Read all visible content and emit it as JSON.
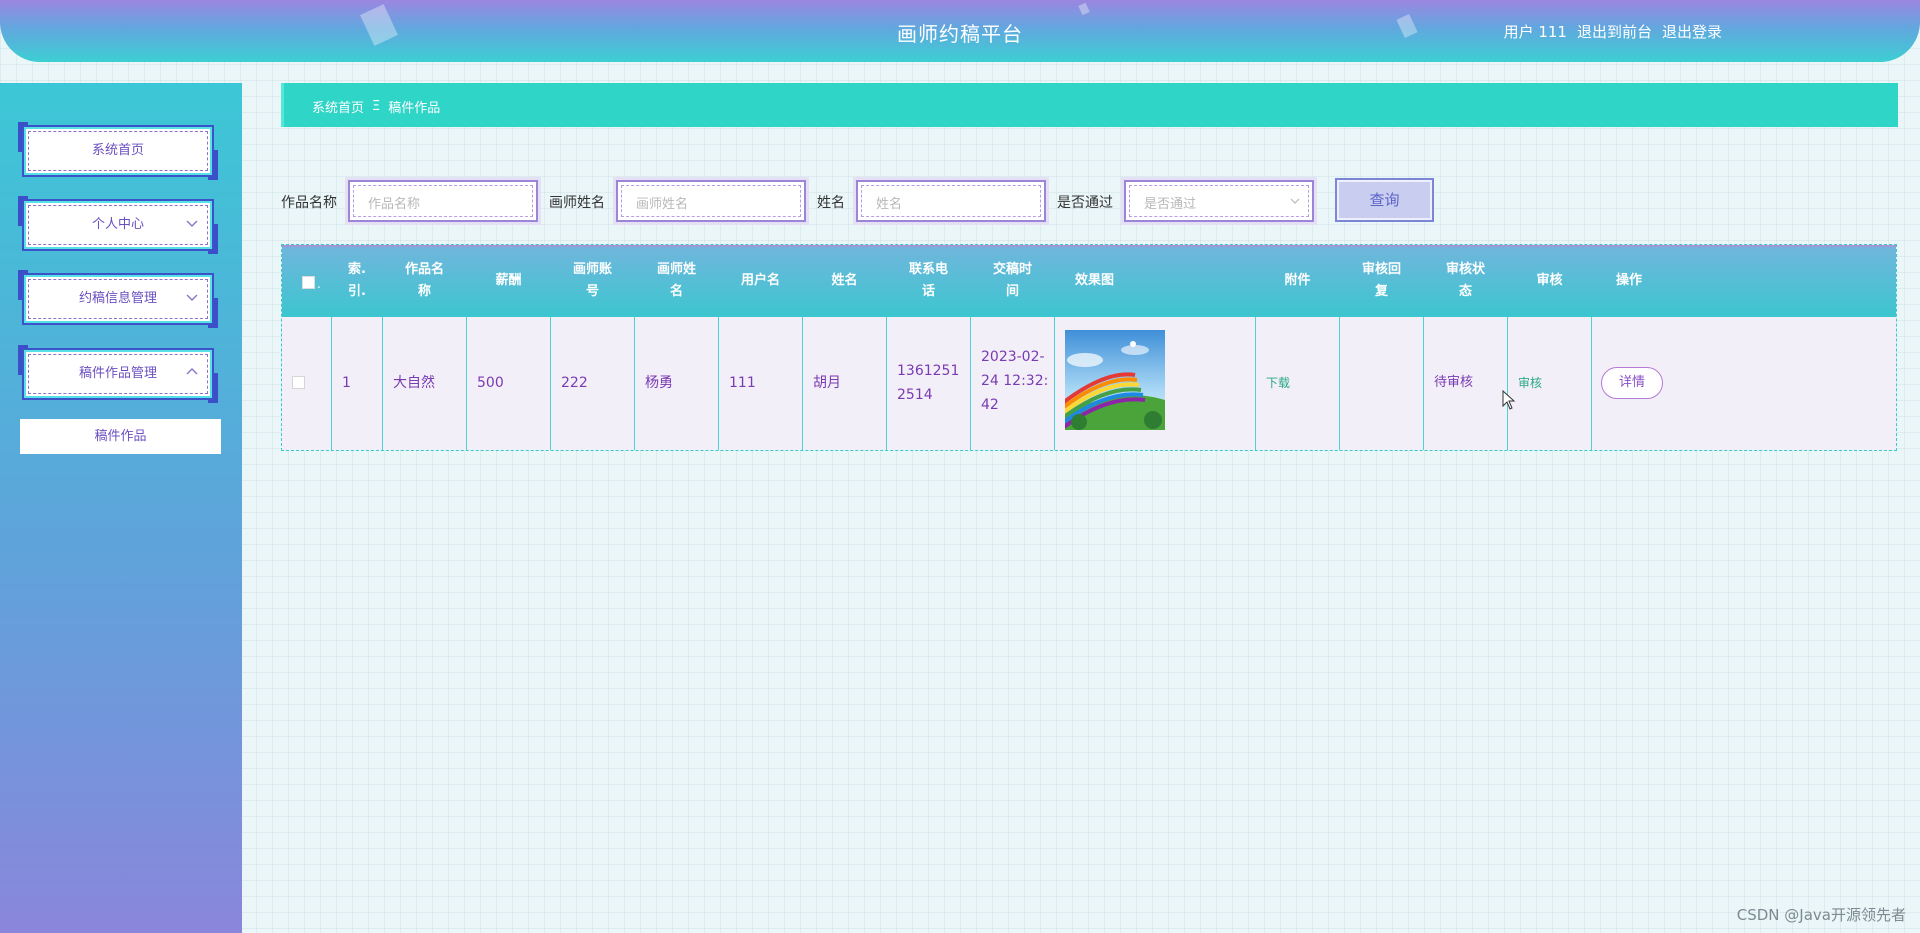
{
  "header": {
    "title": "画师约稿平台",
    "user_label": "用户 111",
    "front_link": "退出到前台",
    "logout_link": "退出登录"
  },
  "sidebar": {
    "items": [
      {
        "label": "系统首页",
        "icon": "none"
      },
      {
        "label": "个人中心",
        "icon": "chevron-down-icon"
      },
      {
        "label": "约稿信息管理",
        "icon": "chevron-down-icon"
      },
      {
        "label": "稿件作品管理",
        "icon": "chevron-up-icon"
      }
    ],
    "sub_item": "稿件作品"
  },
  "breadcrumb": {
    "home": "系统首页",
    "separator": "Ξ",
    "current": "稿件作品"
  },
  "search": {
    "work_name_label": "作品名称",
    "work_name_placeholder": "作品名称",
    "artist_name_label": "画师姓名",
    "artist_name_placeholder": "画师姓名",
    "name_label": "姓名",
    "name_placeholder": "姓名",
    "passed_label": "是否通过",
    "passed_placeholder": "是否通过",
    "query_button": "查询"
  },
  "table": {
    "headers": [
      "索引",
      "作品名称",
      "薪酬",
      "画师账号",
      "画师姓名",
      "用户名",
      "姓名",
      "联系电话",
      "交稿时间",
      "效果图",
      "附件",
      "审核回复",
      "审核状态",
      "审核",
      "操作"
    ],
    "header_display": [
      "索.\n引.",
      "作品名\n称",
      "薪酬",
      "画师账\n号",
      "画师姓\n名",
      "用户名",
      "姓名",
      "联系电\n话",
      "交稿时\n间",
      "效果图",
      "附件",
      "审核回\n复",
      "审核状\n态",
      "审核",
      "操作"
    ],
    "rows": [
      {
        "index": "1",
        "work_name": "大自然",
        "salary": "500",
        "artist_account": "222",
        "artist_name": "杨勇",
        "username": "111",
        "name": "胡月",
        "phone": "13612512514",
        "submit_time": "2023-02-24 12:32:42",
        "preview_image": "rainbow-landscape-image",
        "attachment": "下载",
        "review_reply": "",
        "review_status": "待审核",
        "review_action": "审核",
        "detail_button": "详情"
      }
    ]
  },
  "watermark": "CSDN @Java开源领先者",
  "colors": {
    "accent_teal": "#2fd6c8",
    "accent_purple": "#8a4fc6",
    "sidebar_top": "#3cc7d6",
    "sidebar_bottom": "#8a86db"
  }
}
